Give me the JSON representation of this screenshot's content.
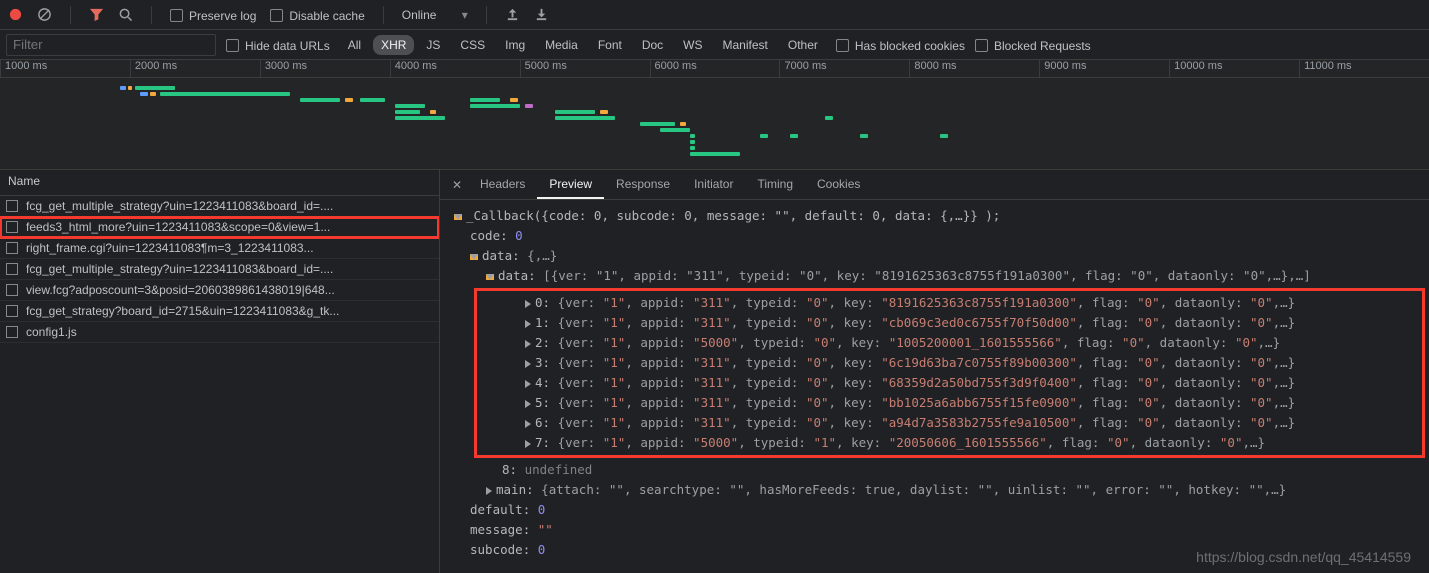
{
  "toolbar": {
    "preserve_log": "Preserve log",
    "disable_cache": "Disable cache",
    "throttle": "Online"
  },
  "filter": {
    "placeholder": "Filter",
    "hide_urls": "Hide data URLs",
    "types": [
      "All",
      "XHR",
      "JS",
      "CSS",
      "Img",
      "Media",
      "Font",
      "Doc",
      "WS",
      "Manifest",
      "Other"
    ],
    "active_type": "XHR",
    "has_blocked": "Has blocked cookies",
    "blocked_req": "Blocked Requests"
  },
  "timeline_ticks": [
    "1000 ms",
    "2000 ms",
    "3000 ms",
    "4000 ms",
    "5000 ms",
    "6000 ms",
    "7000 ms",
    "8000 ms",
    "9000 ms",
    "10000 ms",
    "11000 ms"
  ],
  "req_header": "Name",
  "selected_request_index": 1,
  "requests": [
    "fcg_get_multiple_strategy?uin=1223411083&board_id=....",
    "feeds3_html_more?uin=1223411083&scope=0&view=1...",
    "right_frame.cgi?uin=1223411083&param=3_1223411083...",
    "fcg_get_multiple_strategy?uin=1223411083&board_id=....",
    "view.fcg?adposcount=3&posid=2060389861438019|648...",
    "fcg_get_strategy?board_id=2715&uin=1223411083&g_tk...",
    "config1.js"
  ],
  "tabs": [
    "Headers",
    "Preview",
    "Response",
    "Initiator",
    "Timing",
    "Cookies"
  ],
  "active_tab": "Preview",
  "preview": {
    "root": "_Callback({code: 0, subcode: 0, message: \"\", default: 0, data: {,…}} );",
    "code_label": "code",
    "code_val": "0",
    "data_label": "data",
    "data_head": "{,…}",
    "data_arr_label": "data",
    "data_arr_head": "[{ver: \"1\", appid: \"311\", typeid: \"0\", key: \"8191625363c8755f191a0300\", flag: \"0\", dataonly: \"0\",…},…]",
    "items": [
      {
        "idx": "0",
        "ver": "1",
        "appid": "311",
        "typeid": "0",
        "key": "8191625363c8755f191a0300",
        "flag": "0",
        "dataonly": "0"
      },
      {
        "idx": "1",
        "ver": "1",
        "appid": "311",
        "typeid": "0",
        "key": "cb069c3ed0c6755f70f50d00",
        "flag": "0",
        "dataonly": "0"
      },
      {
        "idx": "2",
        "ver": "1",
        "appid": "5000",
        "typeid": "0",
        "key": "1005200001_1601555566",
        "flag": "0",
        "dataonly": "0"
      },
      {
        "idx": "3",
        "ver": "1",
        "appid": "311",
        "typeid": "0",
        "key": "6c19d63ba7c0755f89b00300",
        "flag": "0",
        "dataonly": "0"
      },
      {
        "idx": "4",
        "ver": "1",
        "appid": "311",
        "typeid": "0",
        "key": "68359d2a50bd755f3d9f0400",
        "flag": "0",
        "dataonly": "0"
      },
      {
        "idx": "5",
        "ver": "1",
        "appid": "311",
        "typeid": "0",
        "key": "bb1025a6abb6755f15fe0900",
        "flag": "0",
        "dataonly": "0"
      },
      {
        "idx": "6",
        "ver": "1",
        "appid": "311",
        "typeid": "0",
        "key": "a94d7a3583b2755fe9a10500",
        "flag": "0",
        "dataonly": "0"
      },
      {
        "idx": "7",
        "ver": "1",
        "appid": "5000",
        "typeid": "1",
        "key": "20050606_1601555566",
        "flag": "0",
        "dataonly": "0"
      }
    ],
    "item8_label": "8",
    "item8_val": "undefined",
    "main_label": "main",
    "main_head": "{attach: \"\", searchtype: \"\", hasMoreFeeds: true, daylist: \"\", uinlist: \"\", error: \"\", hotkey: \"\",…}",
    "default_label": "default",
    "default_val": "0",
    "message_label": "message",
    "message_val": "\"\"",
    "subcode_label": "subcode",
    "subcode_val": "0"
  },
  "watermark": "https://blog.csdn.net/qq_45414559"
}
